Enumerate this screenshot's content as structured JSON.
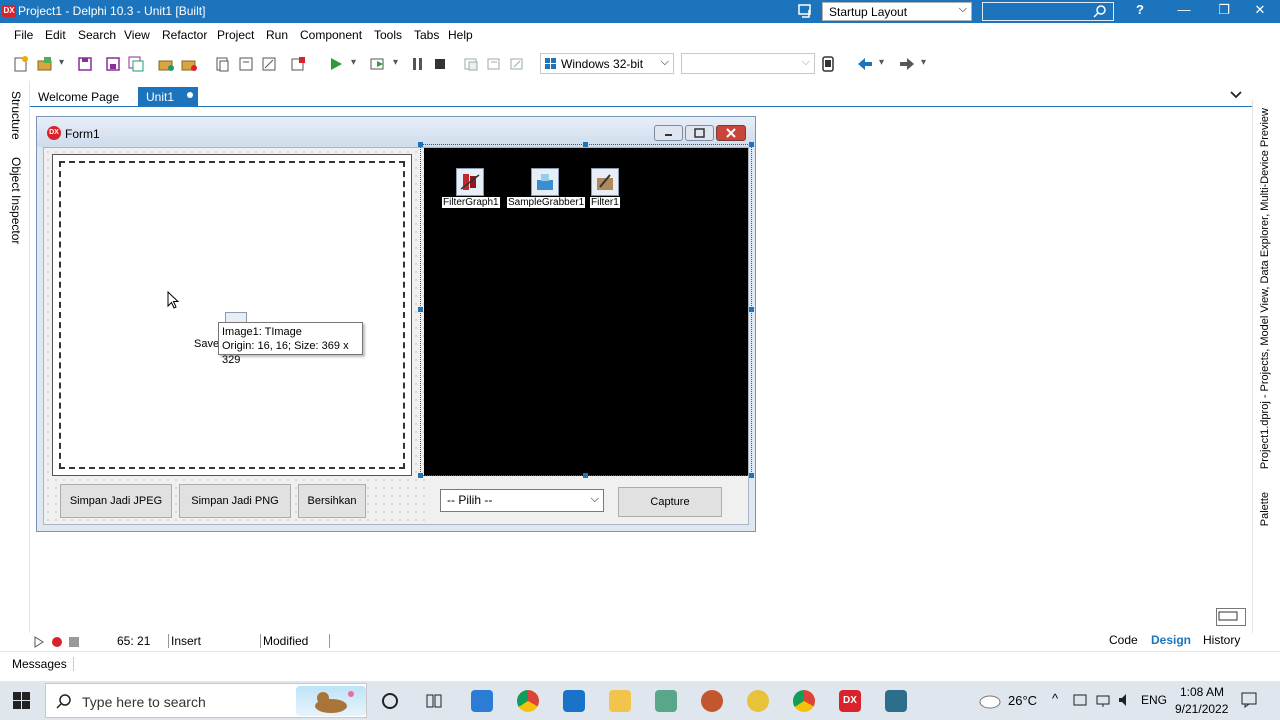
{
  "titlebar": {
    "title": "Project1 - Delphi 10.3 - Unit1 [Built]",
    "logo": "DX",
    "layout_value": "Startup Layout",
    "help_glyph": "?",
    "min_glyph": "—",
    "max_glyph": "❐",
    "close_glyph": "✕",
    "color": "#1c75bc"
  },
  "menu": {
    "items": [
      "File",
      "Edit",
      "Search",
      "View",
      "Refactor",
      "Project",
      "Run",
      "Component",
      "Tools",
      "Tabs",
      "Help"
    ]
  },
  "toolbar": {
    "platform": "Windows 32-bit",
    "config": ""
  },
  "left_tabs": {
    "structure": "Structure",
    "object_inspector": "Object Inspector"
  },
  "right_tabs": {
    "projects": "Project1.dproj - Projects, Model View, Data Explorer, Multi-Device Preview",
    "palette": "Palette"
  },
  "doc_tabs": {
    "welcome": "Welcome Page",
    "unit1": "Unit1"
  },
  "form": {
    "title": "Form1",
    "components": [
      {
        "label": "FilterGraph1",
        "icon": "filtergraph-icon"
      },
      {
        "label": "SampleGrabber1",
        "icon": "samplegrabber-icon"
      },
      {
        "label": "Filter1",
        "icon": "filter-icon"
      }
    ],
    "buttons": {
      "jpeg": "Simpan Jadi JPEG",
      "png": "Simpan Jadi PNG",
      "clear": "Bersihkan",
      "capture": "Capture"
    },
    "combo_value": "-- Pilih --",
    "hidden_label": "Savel",
    "tooltip_line1": "Image1: TImage",
    "tooltip_line2": "Origin: 16, 16; Size: 369 x 329"
  },
  "status": {
    "position": "65: 21",
    "mode": "Insert",
    "modified": "Modified",
    "tab_code": "Code",
    "tab_design": "Design",
    "tab_history": "History",
    "messages": "Messages"
  },
  "taskbar": {
    "search_placeholder": "Type here to search",
    "weather": "26°C",
    "lang": "ENG",
    "time": "1:08 AM",
    "date": "9/21/2022"
  }
}
